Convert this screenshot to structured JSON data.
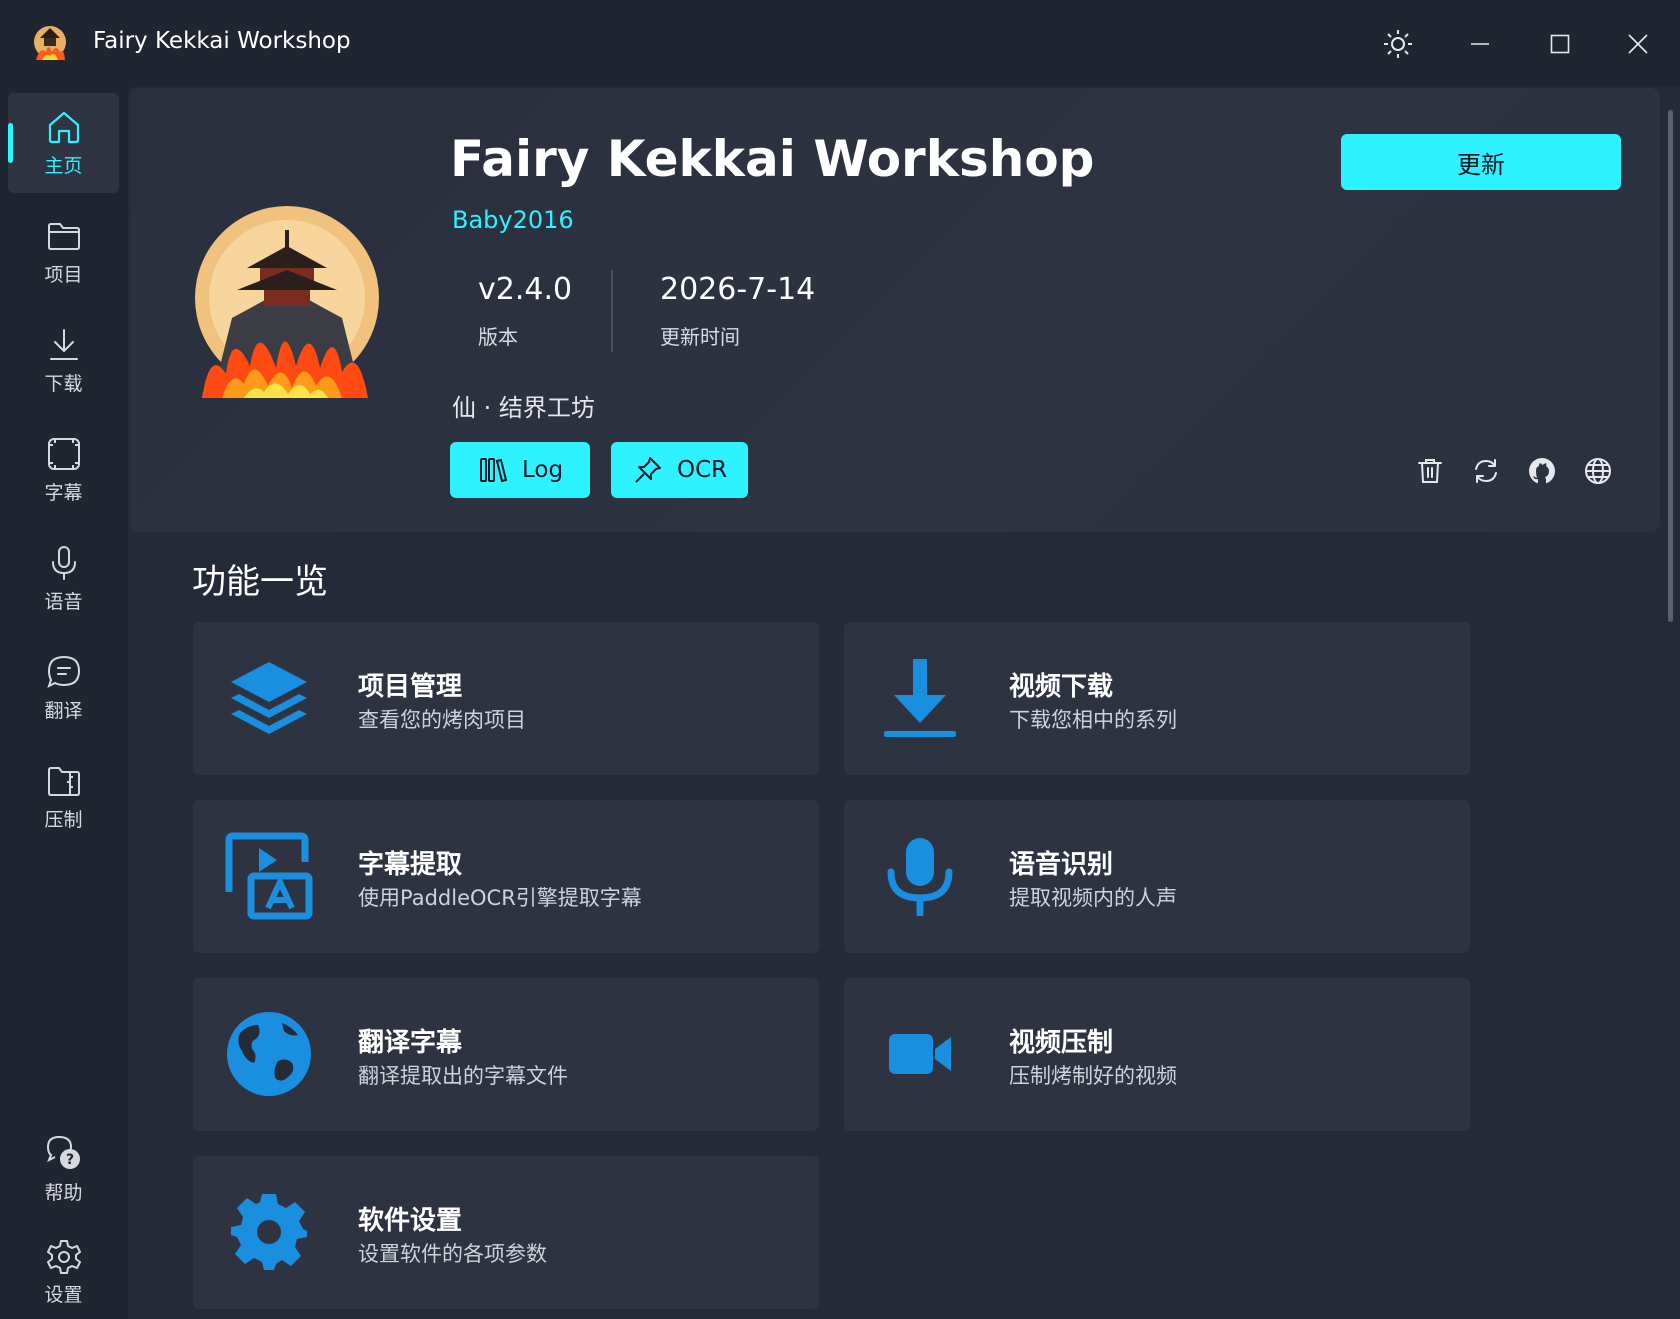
{
  "window": {
    "title": "Fairy Kekkai Workshop",
    "controls": [
      "theme-toggle",
      "minimize",
      "maximize",
      "close"
    ]
  },
  "sidebar": {
    "items": [
      {
        "label": "主页",
        "icon": "home-icon",
        "active": true
      },
      {
        "label": "项目",
        "icon": "folder-icon"
      },
      {
        "label": "下载",
        "icon": "download-icon"
      },
      {
        "label": "字幕",
        "icon": "film-frame-icon"
      },
      {
        "label": "语音",
        "icon": "microphone-icon"
      },
      {
        "label": "翻译",
        "icon": "chat-bubble-icon"
      },
      {
        "label": "压制",
        "icon": "compress-folder-icon"
      }
    ],
    "bottom": [
      {
        "label": "帮助",
        "icon": "help-chat-icon"
      },
      {
        "label": "设置",
        "icon": "gear-icon"
      }
    ]
  },
  "header": {
    "title": "Fairy Kekkai Workshop",
    "author": "Baby2016",
    "version": "v2.4.0",
    "version_label": "版本",
    "updated": "2026-7-14",
    "updated_label": "更新时间",
    "subtitle": "仙 · 结界工坊",
    "log_button": "Log",
    "ocr_button": "OCR",
    "update_button": "更新",
    "icon_actions": [
      "trash-icon",
      "refresh-icon",
      "github-icon",
      "globe-icon"
    ]
  },
  "main": {
    "section_title": "功能一览",
    "cards": [
      {
        "title": "项目管理",
        "desc": "查看您的烤肉项目",
        "icon": "layers-icon"
      },
      {
        "title": "视频下载",
        "desc": "下载您相中的系列",
        "icon": "download-arrow-icon"
      },
      {
        "title": "字幕提取",
        "desc": "使用PaddleOCR引擎提取字幕",
        "icon": "subtitle-extract-icon"
      },
      {
        "title": "语音识别",
        "desc": "提取视频内的人声",
        "icon": "microphone-icon"
      },
      {
        "title": "翻译字幕",
        "desc": "翻译提取出的字幕文件",
        "icon": "globe-icon"
      },
      {
        "title": "视频压制",
        "desc": "压制烤制好的视频",
        "icon": "video-camera-icon"
      },
      {
        "title": "软件设置",
        "desc": "设置软件的各项参数",
        "icon": "gear-icon"
      }
    ]
  },
  "colors": {
    "accent": "#2ef2ff",
    "feature_icon": "#1a8fe0",
    "background": "#252a38",
    "card": "#2e3342"
  }
}
